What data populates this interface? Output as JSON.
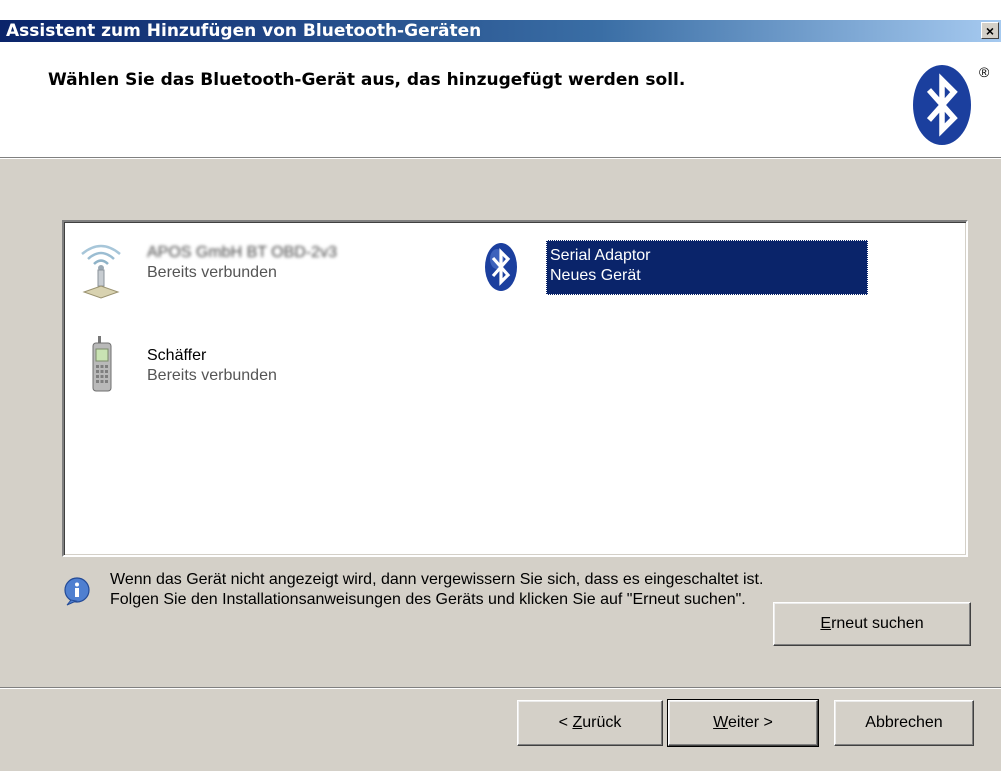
{
  "window": {
    "title": "Assistent zum Hinzufügen von Bluetooth-Geräten",
    "close_label": "×"
  },
  "header": {
    "title": "Wählen Sie das Bluetooth-Gerät aus, das hinzugefügt werden soll.",
    "logo_icon": "bluetooth-logo-icon",
    "registered_mark": "®"
  },
  "devices": [
    {
      "name": "APOS GmbH BT OBD-2v3",
      "status": "Bereits verbunden",
      "icon": "network-access-point-icon",
      "selected": false,
      "name_obscured": true
    },
    {
      "name": "Serial Adaptor",
      "status": "Neues Gerät",
      "icon": "bluetooth-device-icon",
      "selected": true
    },
    {
      "name": "Schäffer",
      "status": "Bereits verbunden",
      "icon": "mobile-phone-icon",
      "selected": false
    }
  ],
  "info": {
    "icon": "info-icon",
    "text": "Wenn das Gerät nicht angezeigt wird, dann vergewissern Sie sich, dass es eingeschaltet ist. Folgen Sie den Installationsanweisungen des Geräts und klicken Sie auf \"Erneut suchen\"."
  },
  "buttons": {
    "search_again": {
      "mnemonic": "E",
      "rest": "rneut suchen"
    },
    "back": {
      "prefix": "< ",
      "mnemonic": "Z",
      "rest": "urück"
    },
    "next": {
      "mnemonic": "W",
      "rest": "eiter >"
    },
    "cancel": "Abbrechen"
  },
  "colors": {
    "titlebar": "#0a246a",
    "selection": "#0a246a",
    "dialog_face": "#d4d0c8",
    "bluetooth_blue": "#1b3f9e"
  }
}
